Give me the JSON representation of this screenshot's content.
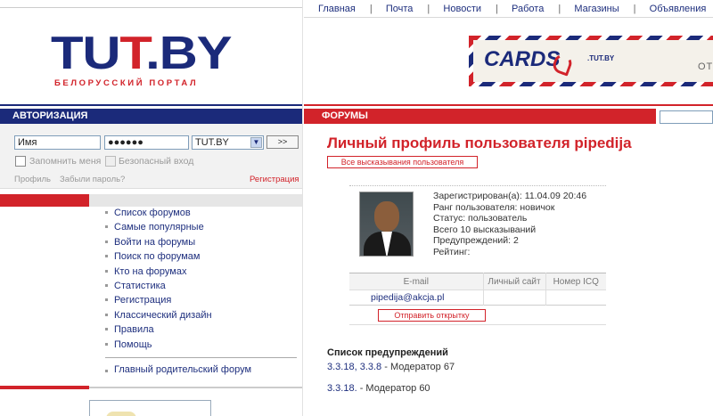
{
  "topnav": {
    "items": [
      "Главная",
      "Почта",
      "Новости",
      "Работа",
      "Магазины",
      "Объявления"
    ]
  },
  "logo": {
    "brand_left": "TU",
    "brand_red": "T",
    "brand_right": ".BY",
    "tagline": "БЕЛОРУССКИЙ ПОРТАЛ"
  },
  "banner": {
    "cards_text": "CARDS",
    "tutby": ".TUT.BY",
    "tail": "ОТ"
  },
  "auth": {
    "header": "АВТОРИЗАЦИЯ",
    "username_value": "Имя",
    "password_value": "●●●●●●",
    "domain_value": "TUT.BY",
    "submit_label": ">>",
    "remember_label": "Запомнить меня",
    "secure_label": "Безопасный вход",
    "profile_link": "Профиль",
    "forgot_link": "Забыли пароль?",
    "register_link": "Регистрация"
  },
  "menu": {
    "items": [
      "Список форумов",
      "Самые популярные",
      "Войти на форумы",
      "Поиск по форумам",
      "Кто на форумах",
      "Статистика",
      "Регистрация",
      "Классический дизайн",
      "Правила",
      "Помощь"
    ],
    "last": "Главный родительский форум"
  },
  "forums": {
    "header": "ФОРУМЫ"
  },
  "profile": {
    "title": "Личный профиль пользователя pipedija",
    "all_posts_button": "Все высказывания пользователя",
    "info": [
      "Зарегистрирован(а): 11.04.09 20:46",
      "Ранг пользователя: новичок",
      "Статус: пользователь",
      "Всего 10 высказываний",
      "Предупреждений: 2",
      "Рейтинг:"
    ],
    "contacts": {
      "headers": [
        "E-mail",
        "Личный сайт",
        "Номер ICQ"
      ],
      "email": "pipedija@akcja.pl",
      "site": "",
      "icq": ""
    },
    "send_card_button": "Отправить открытку"
  },
  "warnings": {
    "title": "Список предупреждений",
    "lines": [
      {
        "links": "3.3.18, 3.3.8",
        "text": " - Модератор 67"
      },
      {
        "links": "3.3.18.",
        "text": " - Модератор 60"
      }
    ]
  },
  "colors": {
    "brand_blue": "#1b2a7a",
    "brand_red": "#d2232a",
    "link": "#1e2f7e"
  }
}
